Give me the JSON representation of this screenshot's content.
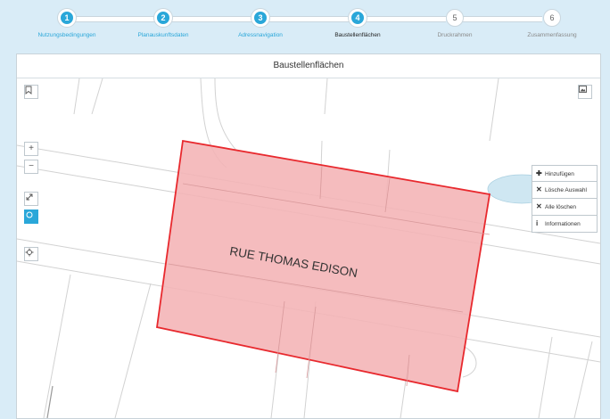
{
  "stepper": {
    "steps": [
      {
        "number": "1",
        "label": "Nutzungsbedingungen",
        "state": "done"
      },
      {
        "number": "2",
        "label": "Planauskunftsdaten",
        "state": "done"
      },
      {
        "number": "3",
        "label": "Adressnavigation",
        "state": "done"
      },
      {
        "number": "4",
        "label": "Baustellenflächen",
        "state": "current"
      },
      {
        "number": "5",
        "label": "Druckrahmen",
        "state": "todo"
      },
      {
        "number": "6",
        "label": "Zusammenfassung",
        "state": "todo"
      }
    ],
    "done_color": "#2aa7d9"
  },
  "panel": {
    "title": "Baustellenflächen"
  },
  "map": {
    "street_label": "RUE THOMAS EDISON",
    "polygon_fill": "#f4b3b5",
    "polygon_stroke": "#e8292e",
    "controls": {
      "bookmark_icon": "bookmark-icon",
      "layers_icon": "image-icon",
      "zoom_in": "+",
      "zoom_out": "−",
      "fullscreen_icon": "expand-icon",
      "locate_icon": "crosshair-icon"
    },
    "tools": [
      {
        "icon": "✚",
        "label": "Hinzufügen"
      },
      {
        "icon": "✕",
        "label": "Lösche Auswahl"
      },
      {
        "icon": "✕",
        "label": "Alle löschen"
      },
      {
        "icon": "i",
        "label": "Informationen"
      }
    ]
  }
}
